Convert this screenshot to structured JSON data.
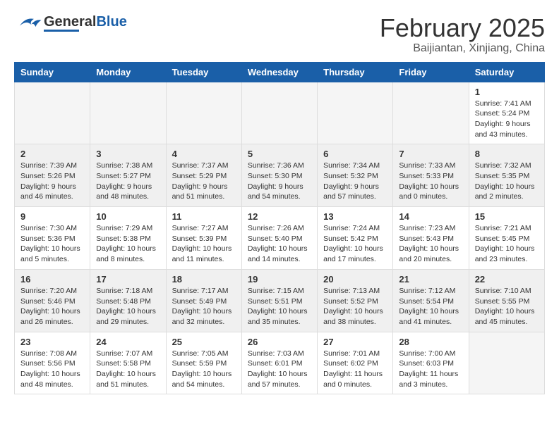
{
  "header": {
    "logo_general": "General",
    "logo_blue": "Blue",
    "month_year": "February 2025",
    "location": "Baijiantan, Xinjiang, China"
  },
  "days_of_week": [
    "Sunday",
    "Monday",
    "Tuesday",
    "Wednesday",
    "Thursday",
    "Friday",
    "Saturday"
  ],
  "weeks": [
    {
      "days": [
        {
          "date": "",
          "info": ""
        },
        {
          "date": "",
          "info": ""
        },
        {
          "date": "",
          "info": ""
        },
        {
          "date": "",
          "info": ""
        },
        {
          "date": "",
          "info": ""
        },
        {
          "date": "",
          "info": ""
        },
        {
          "date": "1",
          "info": "Sunrise: 7:41 AM\nSunset: 5:24 PM\nDaylight: 9 hours and 43 minutes."
        }
      ]
    },
    {
      "days": [
        {
          "date": "2",
          "info": "Sunrise: 7:39 AM\nSunset: 5:26 PM\nDaylight: 9 hours and 46 minutes."
        },
        {
          "date": "3",
          "info": "Sunrise: 7:38 AM\nSunset: 5:27 PM\nDaylight: 9 hours and 48 minutes."
        },
        {
          "date": "4",
          "info": "Sunrise: 7:37 AM\nSunset: 5:29 PM\nDaylight: 9 hours and 51 minutes."
        },
        {
          "date": "5",
          "info": "Sunrise: 7:36 AM\nSunset: 5:30 PM\nDaylight: 9 hours and 54 minutes."
        },
        {
          "date": "6",
          "info": "Sunrise: 7:34 AM\nSunset: 5:32 PM\nDaylight: 9 hours and 57 minutes."
        },
        {
          "date": "7",
          "info": "Sunrise: 7:33 AM\nSunset: 5:33 PM\nDaylight: 10 hours and 0 minutes."
        },
        {
          "date": "8",
          "info": "Sunrise: 7:32 AM\nSunset: 5:35 PM\nDaylight: 10 hours and 2 minutes."
        }
      ]
    },
    {
      "days": [
        {
          "date": "9",
          "info": "Sunrise: 7:30 AM\nSunset: 5:36 PM\nDaylight: 10 hours and 5 minutes."
        },
        {
          "date": "10",
          "info": "Sunrise: 7:29 AM\nSunset: 5:38 PM\nDaylight: 10 hours and 8 minutes."
        },
        {
          "date": "11",
          "info": "Sunrise: 7:27 AM\nSunset: 5:39 PM\nDaylight: 10 hours and 11 minutes."
        },
        {
          "date": "12",
          "info": "Sunrise: 7:26 AM\nSunset: 5:40 PM\nDaylight: 10 hours and 14 minutes."
        },
        {
          "date": "13",
          "info": "Sunrise: 7:24 AM\nSunset: 5:42 PM\nDaylight: 10 hours and 17 minutes."
        },
        {
          "date": "14",
          "info": "Sunrise: 7:23 AM\nSunset: 5:43 PM\nDaylight: 10 hours and 20 minutes."
        },
        {
          "date": "15",
          "info": "Sunrise: 7:21 AM\nSunset: 5:45 PM\nDaylight: 10 hours and 23 minutes."
        }
      ]
    },
    {
      "days": [
        {
          "date": "16",
          "info": "Sunrise: 7:20 AM\nSunset: 5:46 PM\nDaylight: 10 hours and 26 minutes."
        },
        {
          "date": "17",
          "info": "Sunrise: 7:18 AM\nSunset: 5:48 PM\nDaylight: 10 hours and 29 minutes."
        },
        {
          "date": "18",
          "info": "Sunrise: 7:17 AM\nSunset: 5:49 PM\nDaylight: 10 hours and 32 minutes."
        },
        {
          "date": "19",
          "info": "Sunrise: 7:15 AM\nSunset: 5:51 PM\nDaylight: 10 hours and 35 minutes."
        },
        {
          "date": "20",
          "info": "Sunrise: 7:13 AM\nSunset: 5:52 PM\nDaylight: 10 hours and 38 minutes."
        },
        {
          "date": "21",
          "info": "Sunrise: 7:12 AM\nSunset: 5:54 PM\nDaylight: 10 hours and 41 minutes."
        },
        {
          "date": "22",
          "info": "Sunrise: 7:10 AM\nSunset: 5:55 PM\nDaylight: 10 hours and 45 minutes."
        }
      ]
    },
    {
      "days": [
        {
          "date": "23",
          "info": "Sunrise: 7:08 AM\nSunset: 5:56 PM\nDaylight: 10 hours and 48 minutes."
        },
        {
          "date": "24",
          "info": "Sunrise: 7:07 AM\nSunset: 5:58 PM\nDaylight: 10 hours and 51 minutes."
        },
        {
          "date": "25",
          "info": "Sunrise: 7:05 AM\nSunset: 5:59 PM\nDaylight: 10 hours and 54 minutes."
        },
        {
          "date": "26",
          "info": "Sunrise: 7:03 AM\nSunset: 6:01 PM\nDaylight: 10 hours and 57 minutes."
        },
        {
          "date": "27",
          "info": "Sunrise: 7:01 AM\nSunset: 6:02 PM\nDaylight: 11 hours and 0 minutes."
        },
        {
          "date": "28",
          "info": "Sunrise: 7:00 AM\nSunset: 6:03 PM\nDaylight: 11 hours and 3 minutes."
        },
        {
          "date": "",
          "info": ""
        }
      ]
    }
  ]
}
